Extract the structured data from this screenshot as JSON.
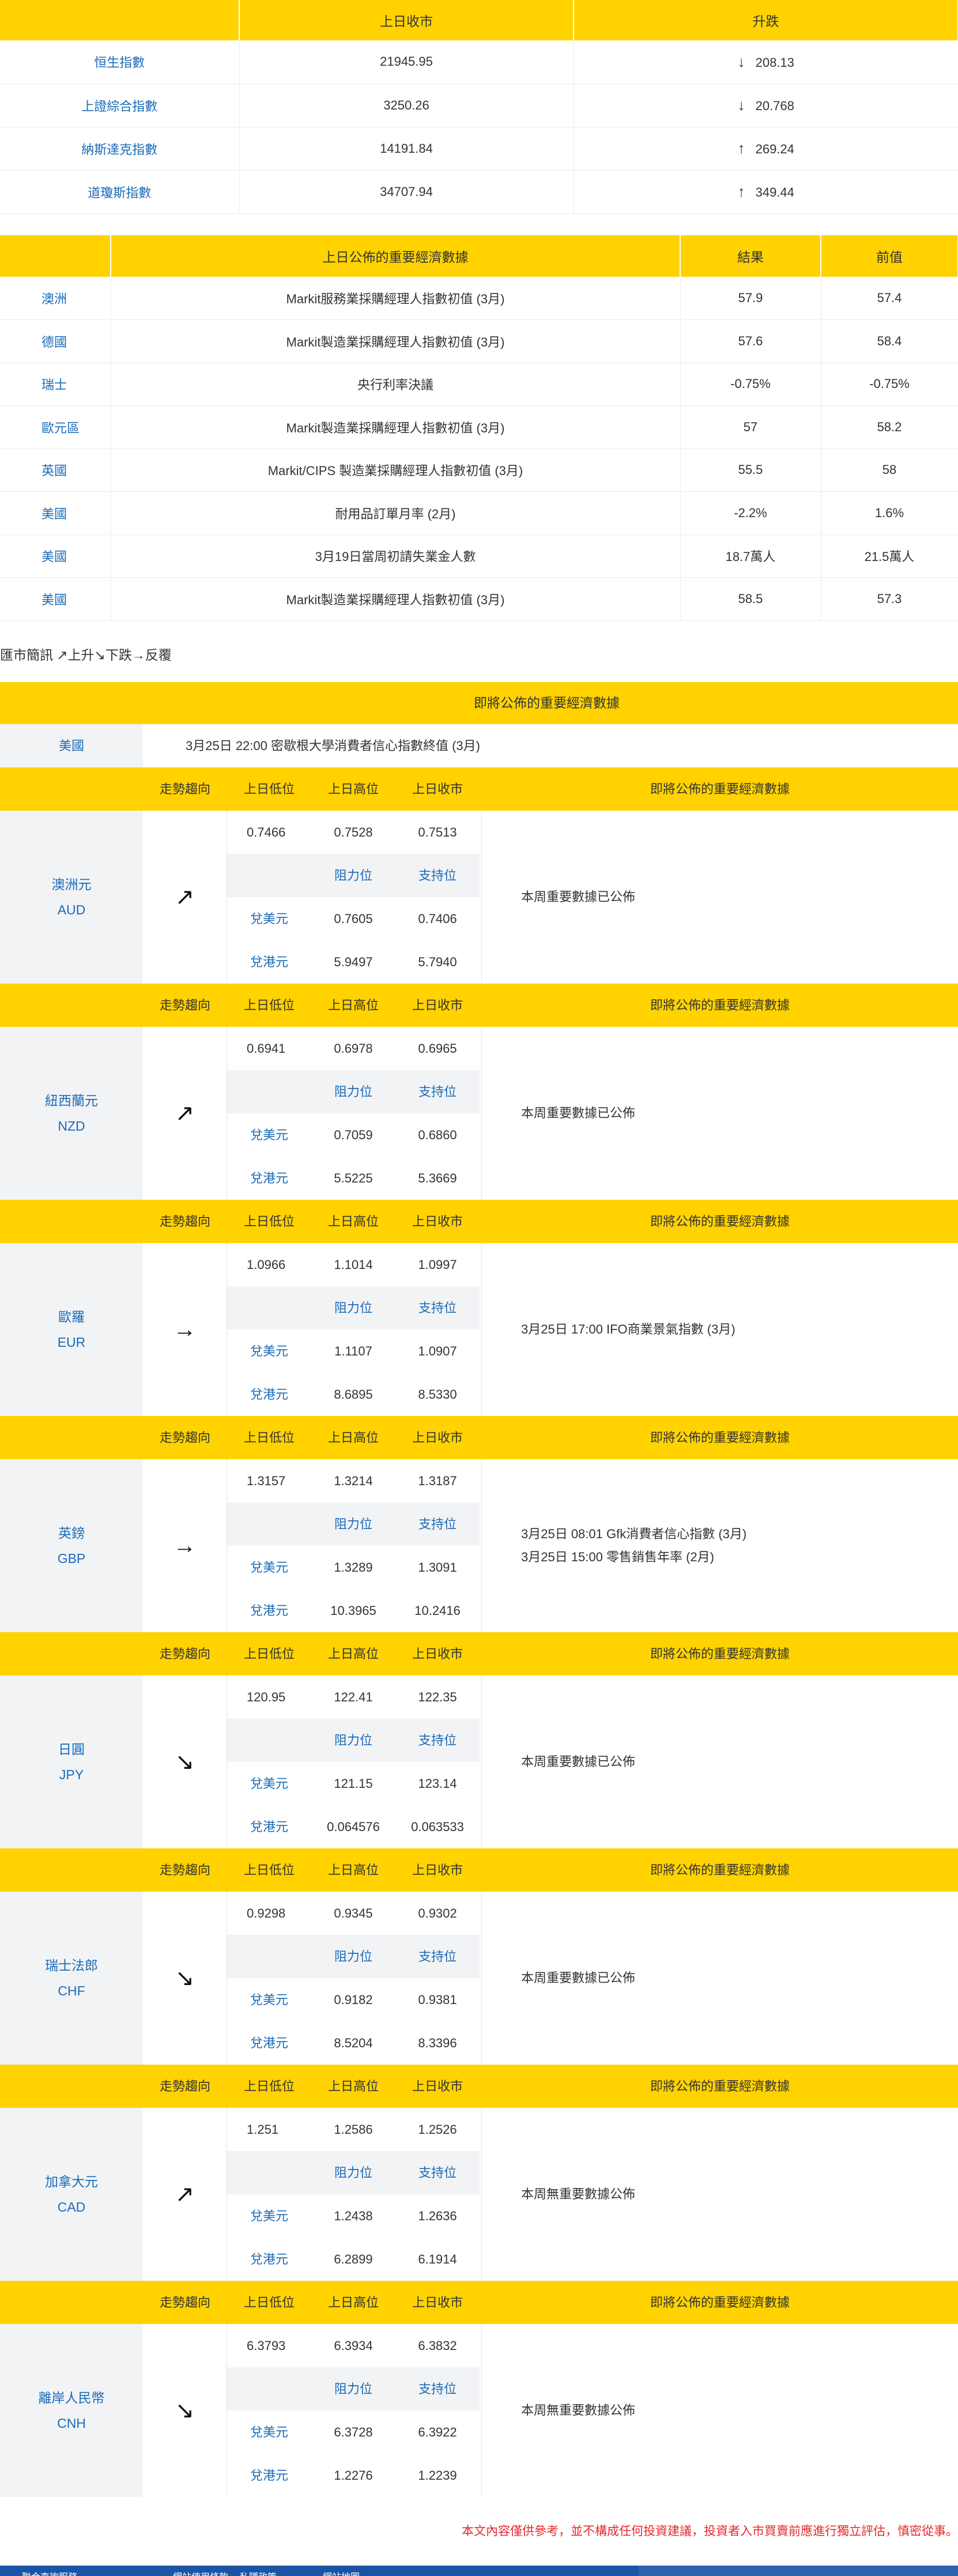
{
  "indices": {
    "headers": [
      "",
      "上日收市",
      "升跌"
    ],
    "rows": [
      {
        "name": "恒生指數",
        "close": "21945.95",
        "dir": "down",
        "arrow": "↓",
        "change": "208.13"
      },
      {
        "name": "上證綜合指數",
        "close": "3250.26",
        "dir": "down",
        "arrow": "↓",
        "change": "20.768"
      },
      {
        "name": "納斯達克指數",
        "close": "14191.84",
        "dir": "up",
        "arrow": "↑",
        "change": "269.24"
      },
      {
        "name": "道瓊斯指數",
        "close": "34707.94",
        "dir": "up",
        "arrow": "↑",
        "change": "349.44"
      }
    ]
  },
  "economic": {
    "headers": [
      "",
      "上日公佈的重要經濟數據",
      "結果",
      "前值"
    ],
    "rows": [
      {
        "region": "澳洲",
        "item": "Markit服務業採購經理人指數初值 (3月)",
        "result": "57.9",
        "prev": "57.4"
      },
      {
        "region": "德國",
        "item": "Markit製造業採購經理人指數初值 (3月)",
        "result": "57.6",
        "prev": "58.4"
      },
      {
        "region": "瑞士",
        "item": "央行利率決議",
        "result": "-0.75%",
        "prev": "-0.75%"
      },
      {
        "region": "歐元區",
        "item": "Markit製造業採購經理人指數初值 (3月)",
        "result": "57",
        "prev": "58.2"
      },
      {
        "region": "英國",
        "item": "Markit/CIPS 製造業採購經理人指數初值 (3月)",
        "result": "55.5",
        "prev": "58"
      },
      {
        "region": "美國",
        "item": "耐用品訂單月率 (2月)",
        "result": "-2.2%",
        "prev": "1.6%"
      },
      {
        "region": "美國",
        "item": "3月19日當周初請失業金人數",
        "result": "18.7萬人",
        "prev": "21.5萬人"
      },
      {
        "region": "美國",
        "item": "Markit製造業採購經理人指數初值 (3月)",
        "result": "58.5",
        "prev": "57.3"
      }
    ]
  },
  "brief": "匯市簡訊 ↗上升↘下跌→反覆",
  "upcoming": {
    "title": "即將公佈的重要經濟數據",
    "region": "美國",
    "text": "3月25日 22:00 密歇根大學消費者信心指數終值 (3月)"
  },
  "block_headers": {
    "trend": "走勢趨向",
    "low": "上日低位",
    "high": "上日高位",
    "close": "上日收市",
    "upcoming": "即將公佈的重要經濟數據",
    "resistance": "阻力位",
    "support": "支持位",
    "vs_usd": "兌美元",
    "vs_hkd": "兌港元"
  },
  "currencies": [
    {
      "name": "澳洲元",
      "code": "AUD",
      "trend": "↗",
      "low": "0.7466",
      "high": "0.7528",
      "close": "0.7513",
      "usd_res": "0.7605",
      "usd_sup": "0.7406",
      "hkd_res": "5.9497",
      "hkd_sup": "5.7940",
      "upcoming": [
        "本周重要數據已公佈"
      ]
    },
    {
      "name": "紐西蘭元",
      "code": "NZD",
      "trend": "↗",
      "low": "0.6941",
      "high": "0.6978",
      "close": "0.6965",
      "usd_res": "0.7059",
      "usd_sup": "0.6860",
      "hkd_res": "5.5225",
      "hkd_sup": "5.3669",
      "upcoming": [
        "本周重要數據已公佈"
      ]
    },
    {
      "name": "歐羅",
      "code": "EUR",
      "trend": "→",
      "low": "1.0966",
      "high": "1.1014",
      "close": "1.0997",
      "usd_res": "1.1107",
      "usd_sup": "1.0907",
      "hkd_res": "8.6895",
      "hkd_sup": "8.5330",
      "upcoming": [
        "3月25日 17:00 IFO商業景氣指數 (3月)"
      ]
    },
    {
      "name": "英鎊",
      "code": "GBP",
      "trend": "→",
      "low": "1.3157",
      "high": "1.3214",
      "close": "1.3187",
      "usd_res": "1.3289",
      "usd_sup": "1.3091",
      "hkd_res": "10.3965",
      "hkd_sup": "10.2416",
      "upcoming": [
        "3月25日 08:01 Gfk消費者信心指數 (3月)",
        "3月25日 15:00 零售銷售年率 (2月)"
      ]
    },
    {
      "name": "日圓",
      "code": "JPY",
      "trend": "↘",
      "low": "120.95",
      "high": "122.41",
      "close": "122.35",
      "usd_res": "121.15",
      "usd_sup": "123.14",
      "hkd_res": "0.064576",
      "hkd_sup": "0.063533",
      "upcoming": [
        "本周重要數據已公佈"
      ]
    },
    {
      "name": "瑞士法郎",
      "code": "CHF",
      "trend": "↘",
      "low": "0.9298",
      "high": "0.9345",
      "close": "0.9302",
      "usd_res": "0.9182",
      "usd_sup": "0.9381",
      "hkd_res": "8.5204",
      "hkd_sup": "8.3396",
      "upcoming": [
        "本周重要數據已公佈"
      ]
    },
    {
      "name": "加拿大元",
      "code": "CAD",
      "trend": "↗",
      "low": "1.251",
      "high": "1.2586",
      "close": "1.2526",
      "usd_res": "1.2438",
      "usd_sup": "1.2636",
      "hkd_res": "6.2899",
      "hkd_sup": "6.1914",
      "upcoming": [
        "本周無重要數據公佈"
      ]
    },
    {
      "name": "離岸人民幣",
      "code": "CNH",
      "trend": "↘",
      "low": "6.3793",
      "high": "6.3934",
      "close": "6.3832",
      "usd_res": "6.3728",
      "usd_sup": "6.3922",
      "hkd_res": "1.2276",
      "hkd_sup": "1.2239",
      "upcoming": [
        "本周無重要數據公佈"
      ]
    }
  ],
  "disclaimer": "本文內容僅供參考，並不構成任何投資建議，投資者入市買賣前應進行獨立評估，慎密從事。",
  "footer": {
    "links": [
      "聯合查詢服務",
      "網站使用條款",
      "私隱政策",
      "網站地圖"
    ]
  },
  "colors": {
    "accent": "#ffd200",
    "link": "#1a6bb8",
    "shade": "#f2f3f5",
    "disclaimer": "#e6282d",
    "footer": "#1c54a4"
  }
}
